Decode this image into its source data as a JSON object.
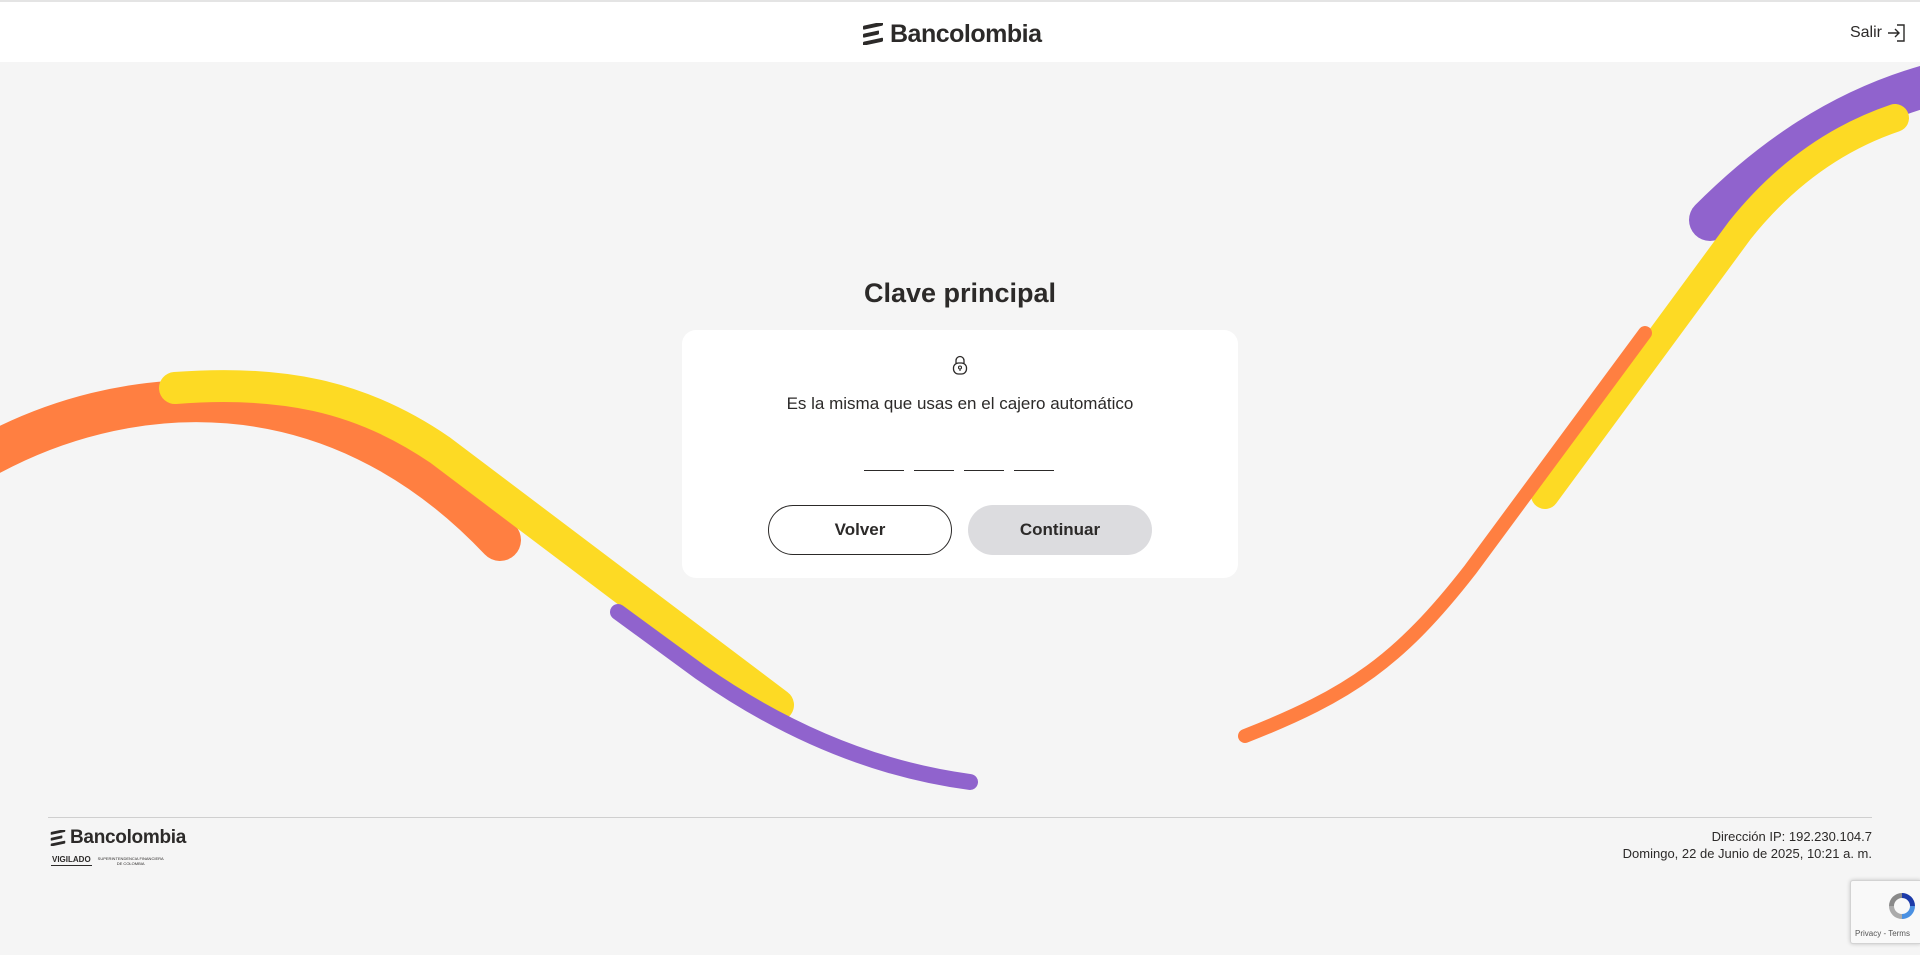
{
  "header": {
    "brand": "Bancolombia",
    "exit_label": "Salir"
  },
  "main": {
    "title": "Clave principal",
    "subtitle": "Es la misma que usas en el cajero automático",
    "pin_fields": 4,
    "back_label": "Volver",
    "continue_label": "Continuar"
  },
  "footer": {
    "brand": "Bancolombia",
    "vigilado": "VIGILADO",
    "regulator": "SUPERINTENDENCIA FINANCIERA DE COLOMBIA",
    "ip": "Dirección IP: 192.230.104.7",
    "datetime": "Domingo, 22 de Junio de 2025, 10:21 a. m."
  },
  "recaptcha": {
    "links": "Privacy - Terms"
  },
  "colors": {
    "orange": "#ff7f41",
    "yellow": "#fdda24",
    "purple": "#9063cd",
    "text": "#2c2a29",
    "disabled_button": "#dcdcdf"
  },
  "icons": [
    "bancolombia-logo-icon",
    "exit-icon",
    "lock-icon",
    "recaptcha-icon"
  ]
}
